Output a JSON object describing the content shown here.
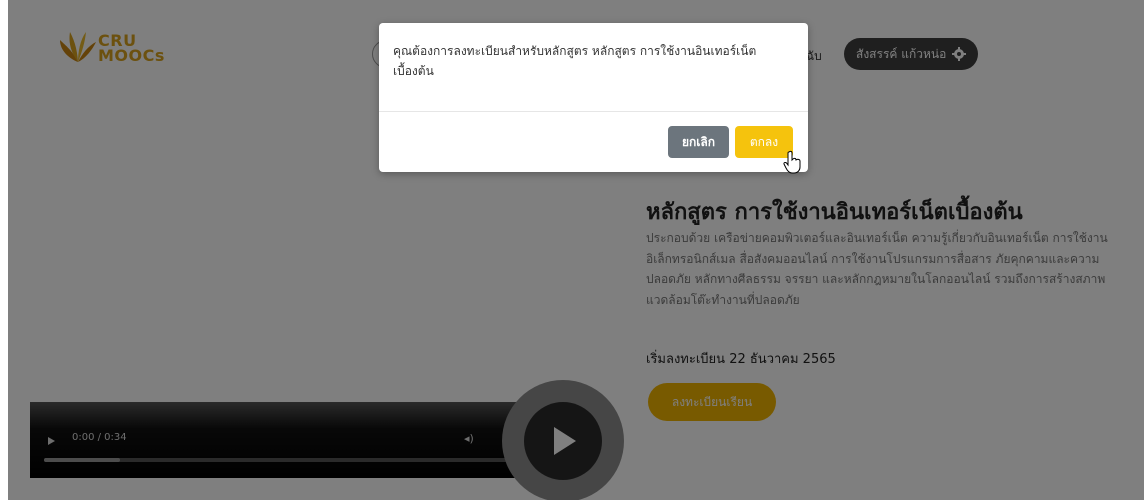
{
  "header": {
    "logo_text_line1": "CRU",
    "logo_text_line2": "MOOCs",
    "nav_partial": "ฉับ",
    "user_name": "สังสรรค์ แก้วหน่อ"
  },
  "course": {
    "title": "หลักสูตร การใช้งานอินเทอร์เน็ตเบื้องต้น",
    "description": "ประกอบด้วย เครือข่ายคอมพิวเตอร์และอินเทอร์เน็ต ความรู้เกี่ยวกับอินเทอร์เน็ต การใช้งานอิเล็กทรอนิกส์เมล สื่อสังคมออนไลน์ การใช้งานโปรแกรมการสื่อสาร ภัยคุกคามและความปลอดภัย หลักทางศีลธรรม จรรยา และหลักกฎหมายในโลกออนไลน์ รวมถึงการสร้างสภาพแวดล้อมโต๊ะทำงานที่ปลอดภัย",
    "start_date": "เริ่มลงทะเบียน 22 ธันวาคม 2565",
    "enroll_label": "ลงทะเบียนเรียน"
  },
  "video": {
    "time": "0:00 / 0:34",
    "progress": 0.14
  },
  "modal": {
    "message": "คุณต้องการลงทะเบียนสำหรับหลักสูตร หลักสูตร การใช้งานอินเทอร์เน็ตเบื้องต้น",
    "cancel_label": "ยกเลิก",
    "ok_label": "ตกลง"
  },
  "colors": {
    "accent": "#f5c30d",
    "cancel": "#6c757d",
    "enroll": "#f0b400"
  }
}
